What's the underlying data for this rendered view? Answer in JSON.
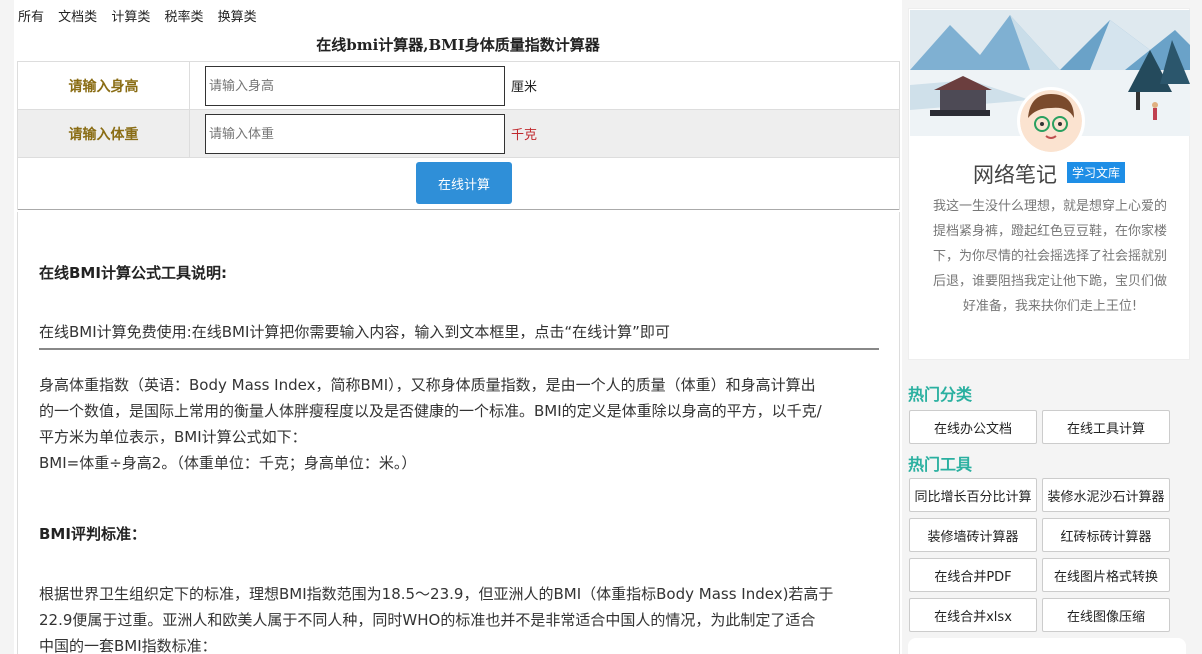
{
  "nav": [
    "所有",
    "文档类",
    "计算类",
    "税率类",
    "换算类"
  ],
  "title": "在线bmi计算器,BMI身体质量指数计算器",
  "form": {
    "height_label": "请输入身高",
    "height_placeholder": "请输入身高",
    "height_unit": "厘米",
    "weight_label": "请输入体重",
    "weight_placeholder": "请输入体重",
    "weight_unit": "千克",
    "calc_button": "在线计算"
  },
  "content": {
    "heading1": "在线BMI计算公式工具说明:",
    "intro": "在线BMI计算免费使用:在线BMI计算把你需要输入内容，输入到文本框里，点击“在线计算”即可",
    "para1_l1": "身高体重指数（英语：Body Mass Index，简称BMI），又称身体质量指数，是由一个人的质量（体重）和身高计算出",
    "para1_l2": "的一个数值，是国际上常用的衡量人体胖瘦程度以及是否健康的一个标准。BMI的定义是体重除以身高的平方，以千克/",
    "para1_l3": "平方米为单位表示，BMI计算公式如下：",
    "formula": "BMI=体重÷身高2。（体重单位：千克；身高单位：米。）",
    "heading2": "BMI评判标准：",
    "para2_l1": "根据世界卫生组织定下的标准，理想BMI指数范围为18.5～23.9，但亚洲人的BMI（体重指标Body Mass Index)若高于",
    "para2_l2": "22.9便属于过重。亚洲人和欧美人属于不同人种，同时WHO的标准也并不是非常适合中国人的情况，为此制定了适合",
    "para2_l3": "中国的一套BMI指数标准："
  },
  "sidebar": {
    "name": "网络笔记",
    "badge": "学习文库",
    "motto": "我这一生没什么理想，就是想穿上心爱的提档紧身裤，蹬起红色豆豆鞋，在你家楼下，为你尽情的社会摇选择了社会摇就别后退，谁要阻挡我定让他下跪，宝贝们做好准备，我来扶你们走上王位!",
    "hot_category_title": "热门分类",
    "hot_categories": [
      "在线办公文档",
      "在线工具计算"
    ],
    "hot_tools_title": "热门工具",
    "hot_tools": [
      "同比增长百分比计算",
      "装修水泥沙石计算器",
      "装修墙砖计算器",
      "红砖标砖计算器",
      "在线合并PDF",
      "在线图片格式转换",
      "在线合并xlsx",
      "在线图像压缩"
    ]
  }
}
